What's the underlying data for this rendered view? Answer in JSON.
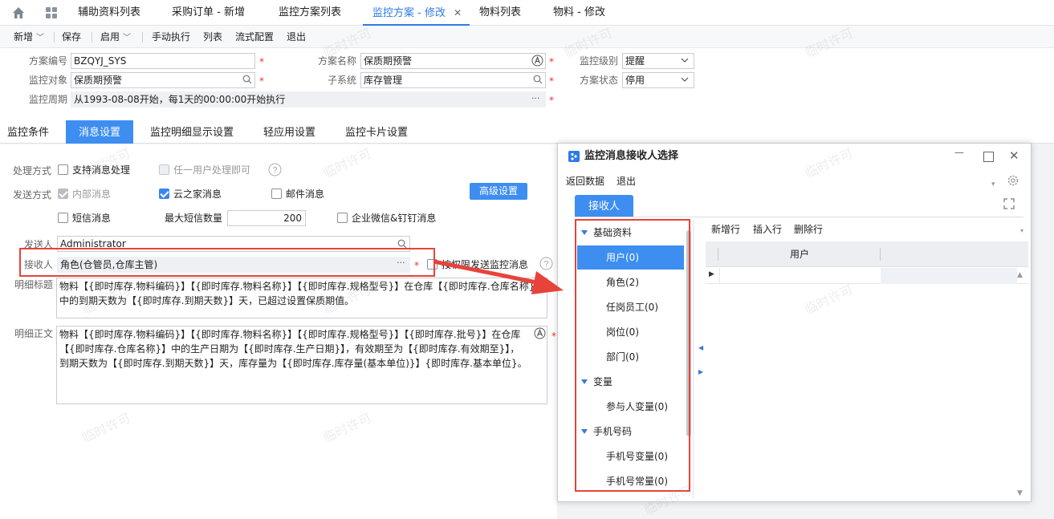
{
  "tabbar": {
    "tabs": [
      {
        "label": "辅助资料列表"
      },
      {
        "label": "采购订单 - 新增"
      },
      {
        "label": "监控方案列表"
      },
      {
        "label": "监控方案 - 修改",
        "active": true
      },
      {
        "label": "物料列表"
      },
      {
        "label": "物料 - 修改"
      }
    ],
    "close_glyph": "✕"
  },
  "toolbar": {
    "items": [
      "新增",
      "保存",
      "启用",
      "手动执行",
      "列表",
      "流式配置",
      "退出"
    ],
    "dropdown_glyph": "﹀"
  },
  "form": {
    "scheme_no": {
      "label": "方案编号",
      "value": "BZQYJ_SYS"
    },
    "scheme_name": {
      "label": "方案名称",
      "value": "保质期预警"
    },
    "level": {
      "label": "监控级别",
      "value": "提醒"
    },
    "target": {
      "label": "监控对象",
      "value": "保质期预警"
    },
    "subsystem": {
      "label": "子系统",
      "value": "库存管理"
    },
    "status": {
      "label": "方案状态",
      "value": "停用"
    },
    "period": {
      "label": "监控周期",
      "value": "从1993-08-08开始，每1天的00:00:00开始执行"
    },
    "required_mark": "*",
    "more_glyph": "···"
  },
  "subtabs": [
    "监控条件",
    "消息设置",
    "监控明细显示设置",
    "轻应用设置",
    "监控卡片设置"
  ],
  "msg": {
    "handle_label": "处理方式",
    "support_msg": "支持消息处理",
    "any_user": "任一用户处理即可",
    "send_label": "发送方式",
    "internal": "内部消息",
    "cloud": "云之家消息",
    "mail": "邮件消息",
    "sms": "短信消息",
    "max_sms_label": "最大短信数量",
    "max_sms_value": "200",
    "wechat": "企业微信&钉钉消息",
    "advanced_btn": "高级设置",
    "sender_label": "发送人",
    "sender_value": "Administrator",
    "receiver_label": "接收人",
    "receiver_value": "角色(仓管员,仓库主管)",
    "by_permission": "按权限发送监控消息",
    "detail_title_label": "明细标题",
    "detail_title": "物料【{即时库存.物料编码}】【{即时库存.物料名称}】【{即时库存.规格型号}】在仓库【{即时库存.仓库名称}】中的到期天数为【{即时库存.到期天数}】天，已超过设置保质期值。",
    "detail_body_label": "明细正文",
    "detail_body": "物料【{即时库存.物料编码}】【{即时库存.物料名称}】【{即时库存.规格型号}】【{即时库存.批号}】在仓库【{即时库存.仓库名称}】中的生产日期为【{即时库存.生产日期}】，有效期至为【{即时库存.有效期至}】，到期天数为【{即时库存.到期天数}】天，库存量为【{即时库存.库存量(基本单位)}】{即时库存.基本单位}。",
    "help_glyph": "?"
  },
  "dialog": {
    "title": "监控消息接收人选择",
    "menu": [
      "返回数据",
      "退出"
    ],
    "tab": "接收人",
    "tree": [
      {
        "label": "基础资料",
        "group": true
      },
      {
        "label": "用户(0)",
        "selected": true
      },
      {
        "label": "角色(2)"
      },
      {
        "label": "任岗员工(0)"
      },
      {
        "label": "岗位(0)"
      },
      {
        "label": "部门(0)"
      },
      {
        "label": "变量",
        "group": true
      },
      {
        "label": "参与人变量(0)"
      },
      {
        "label": "手机号码",
        "group": true
      },
      {
        "label": "手机号变量(0)"
      },
      {
        "label": "手机号常量(0)"
      }
    ],
    "grid_toolbar": [
      "新增行",
      "插入行",
      "删除行"
    ],
    "grid_header": "用户",
    "min_glyph": "—",
    "max_glyph": "☐",
    "close_glyph": "✕"
  },
  "watermark": "临时许可",
  "colors": {
    "accent": "#2e7be6",
    "highlight_box": "#e8433a",
    "selected_row": "#3d8ef0"
  }
}
